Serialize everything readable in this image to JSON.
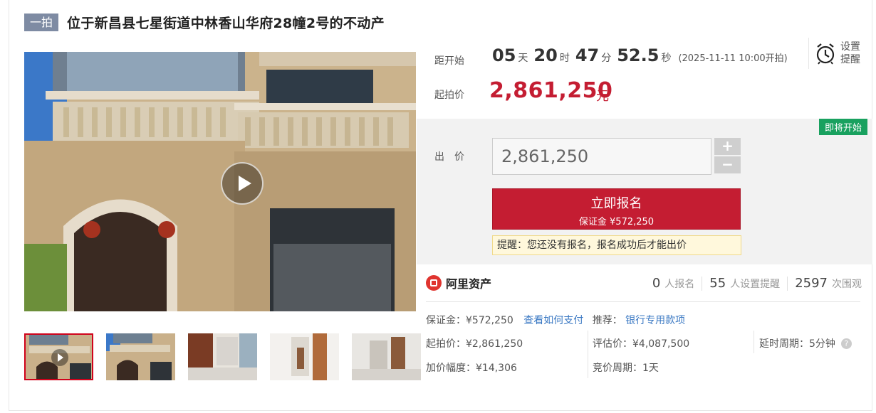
{
  "header": {
    "tag": "一拍",
    "title": "位于新昌县七星街道中林香山华府28幢2号的不动产"
  },
  "gallery": {
    "thumbnail_count": 5,
    "active_index": 0
  },
  "countdown": {
    "label": "距开始",
    "days": "05",
    "days_unit": "天",
    "hours": "20",
    "hours_unit": "时",
    "minutes": "47",
    "minutes_unit": "分",
    "seconds": "52.5",
    "seconds_unit": "秒",
    "start_note": "(2025-11-11 10:00开拍)"
  },
  "reminder": {
    "label_line1": "设置",
    "label_line2": "提醒",
    "icon": "alarm-clock-icon"
  },
  "starting_price": {
    "label": "起拍价",
    "value": "2,861,250",
    "unit": "元",
    "color": "#c41d32"
  },
  "bid": {
    "status_badge": "即将开始",
    "badge_color": "#19a15f",
    "label": "出　价",
    "input_value": "2,861,250",
    "plus": "+",
    "minus": "−",
    "register_button": "立即报名",
    "deposit_line": "保证金 ¥572,250",
    "notice": "提醒：您还没有报名，报名成功后才能出价"
  },
  "platform": {
    "name": "阿里资产",
    "logo_color": "#e0342f"
  },
  "stats": {
    "registered_count": "0",
    "registered_label": "人报名",
    "reminders_count": "55",
    "reminders_label": "人设置提醒",
    "views_count": "2597",
    "views_label": "次围观"
  },
  "details": {
    "deposit": "保证金：¥572,250",
    "how_to_pay": "查看如何支付",
    "recommend_label": "推荐：",
    "recommend_link": "银行专用款项",
    "starting_price": "起拍价：¥2,861,250",
    "appraisal": "评估价：¥4,087,500",
    "delay_period": "延时周期：5分钟",
    "increment": "加价幅度：¥14,306",
    "bidding_period": "竞价周期：1天"
  }
}
